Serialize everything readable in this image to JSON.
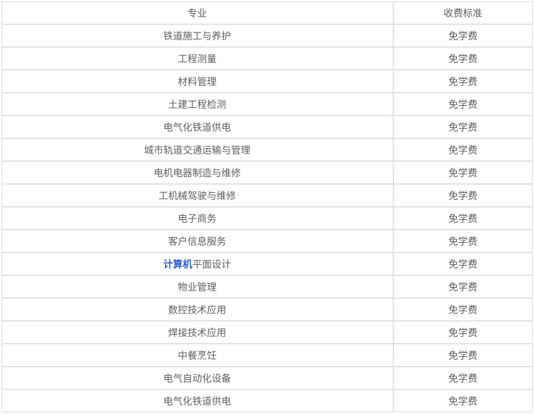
{
  "table": {
    "columns": [
      {
        "key": "major",
        "label": "专业"
      },
      {
        "key": "fee",
        "label": "收费标准"
      }
    ],
    "rows": [
      {
        "major": "铁道施工与养护",
        "fee": "免学费"
      },
      {
        "major": "工程测量",
        "fee": "免学费"
      },
      {
        "major": "材料管理",
        "fee": "免学费"
      },
      {
        "major": "土建工程检测",
        "fee": "免学费"
      },
      {
        "major": "电气化铁道供电",
        "fee": "免学费"
      },
      {
        "major": "城市轨道交通运输与管理",
        "fee": "免学费"
      },
      {
        "major": "电机电器制造与维修",
        "fee": "免学费"
      },
      {
        "major": "工机械驾驶与维修",
        "fee": "免学费"
      },
      {
        "major": "电子商务",
        "fee": "免学费"
      },
      {
        "major": "客户信息服务",
        "fee": "免学费"
      },
      {
        "major": "计算机平面设计",
        "major_link_text": "计算机",
        "major_rest_text": "平面设计",
        "fee": "免学费"
      },
      {
        "major": "物业管理",
        "fee": "免学费"
      },
      {
        "major": "数控技术应用",
        "fee": "免学费"
      },
      {
        "major": "焊接技术应用",
        "fee": "免学费"
      },
      {
        "major": "中餐烹饪",
        "fee": "免学费"
      },
      {
        "major": "电气自动化设备",
        "fee": "免学费"
      },
      {
        "major": "电气化铁道供电",
        "fee": "免学费"
      }
    ]
  },
  "colors": {
    "link_blue": "#2b5cd4",
    "text_gray": "#5e5e5e",
    "border_gray": "#e2e2e2",
    "outer_border_gray": "#dcdcdc",
    "background": "#ffffff"
  }
}
